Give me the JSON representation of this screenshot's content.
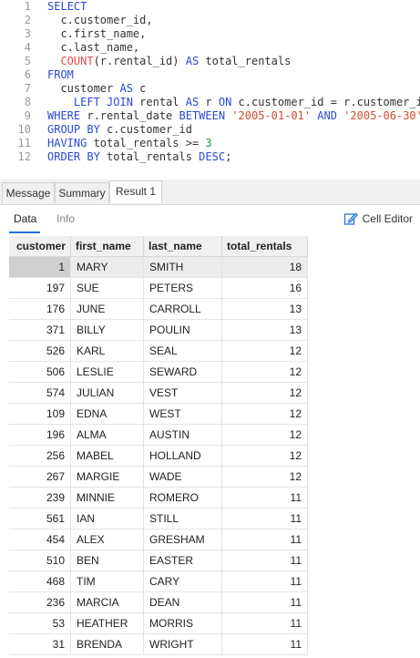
{
  "editor": {
    "lines": [
      {
        "n": "1",
        "parts": [
          {
            "t": "SELECT",
            "c": "kw"
          }
        ]
      },
      {
        "n": "2",
        "parts": [
          {
            "t": "  c.customer_id,",
            "c": "id"
          }
        ]
      },
      {
        "n": "3",
        "parts": [
          {
            "t": "  c.first_name,",
            "c": "id"
          }
        ]
      },
      {
        "n": "4",
        "parts": [
          {
            "t": "  c.last_name,",
            "c": "id"
          }
        ]
      },
      {
        "n": "5",
        "parts": [
          {
            "t": "  ",
            "c": "id"
          },
          {
            "t": "COUNT",
            "c": "fn"
          },
          {
            "t": "(r.rental_id) ",
            "c": "id"
          },
          {
            "t": "AS",
            "c": "kw"
          },
          {
            "t": " total_rentals",
            "c": "id"
          }
        ]
      },
      {
        "n": "6",
        "parts": [
          {
            "t": "FROM",
            "c": "kw"
          }
        ]
      },
      {
        "n": "7",
        "parts": [
          {
            "t": "  customer ",
            "c": "id"
          },
          {
            "t": "AS",
            "c": "kw"
          },
          {
            "t": " c",
            "c": "id"
          }
        ]
      },
      {
        "n": "8",
        "parts": [
          {
            "t": "    ",
            "c": "id"
          },
          {
            "t": "LEFT JOIN",
            "c": "kw"
          },
          {
            "t": " rental ",
            "c": "id"
          },
          {
            "t": "AS",
            "c": "kw"
          },
          {
            "t": " r ",
            "c": "id"
          },
          {
            "t": "ON",
            "c": "kw"
          },
          {
            "t": " c.customer_id = r.customer_id",
            "c": "id"
          }
        ]
      },
      {
        "n": "9",
        "parts": [
          {
            "t": "WHERE",
            "c": "kw"
          },
          {
            "t": " r.rental_date ",
            "c": "id"
          },
          {
            "t": "BETWEEN",
            "c": "kw"
          },
          {
            "t": " ",
            "c": "id"
          },
          {
            "t": "'2005-01-01'",
            "c": "str"
          },
          {
            "t": " ",
            "c": "id"
          },
          {
            "t": "AND",
            "c": "kw"
          },
          {
            "t": " ",
            "c": "id"
          },
          {
            "t": "'2005-06-30'",
            "c": "str"
          }
        ]
      },
      {
        "n": "10",
        "parts": [
          {
            "t": "GROUP BY",
            "c": "kw"
          },
          {
            "t": " c.customer_id",
            "c": "id"
          }
        ]
      },
      {
        "n": "11",
        "parts": [
          {
            "t": "HAVING",
            "c": "kw"
          },
          {
            "t": " total_rentals >= ",
            "c": "id"
          },
          {
            "t": "3",
            "c": "num"
          }
        ]
      },
      {
        "n": "12",
        "parts": [
          {
            "t": "ORDER BY",
            "c": "kw"
          },
          {
            "t": " total_rentals ",
            "c": "id"
          },
          {
            "t": "DESC",
            "c": "kw"
          },
          {
            "t": ";",
            "c": "id"
          }
        ]
      }
    ]
  },
  "tabs": {
    "message": "Message",
    "summary": "Summary",
    "result": "Result 1"
  },
  "subtabs": {
    "data": "Data",
    "info": "Info",
    "cell_editor": "Cell Editor"
  },
  "table": {
    "columns": [
      "customer",
      "first_name",
      "last_name",
      "total_rentals"
    ],
    "rows": [
      [
        "1",
        "MARY",
        "SMITH",
        "18"
      ],
      [
        "197",
        "SUE",
        "PETERS",
        "16"
      ],
      [
        "176",
        "JUNE",
        "CARROLL",
        "13"
      ],
      [
        "371",
        "BILLY",
        "POULIN",
        "13"
      ],
      [
        "526",
        "KARL",
        "SEAL",
        "12"
      ],
      [
        "506",
        "LESLIE",
        "SEWARD",
        "12"
      ],
      [
        "574",
        "JULIAN",
        "VEST",
        "12"
      ],
      [
        "109",
        "EDNA",
        "WEST",
        "12"
      ],
      [
        "196",
        "ALMA",
        "AUSTIN",
        "12"
      ],
      [
        "256",
        "MABEL",
        "HOLLAND",
        "12"
      ],
      [
        "267",
        "MARGIE",
        "WADE",
        "12"
      ],
      [
        "239",
        "MINNIE",
        "ROMERO",
        "11"
      ],
      [
        "561",
        "IAN",
        "STILL",
        "11"
      ],
      [
        "454",
        "ALEX",
        "GRESHAM",
        "11"
      ],
      [
        "510",
        "BEN",
        "EASTER",
        "11"
      ],
      [
        "468",
        "TIM",
        "CARY",
        "11"
      ],
      [
        "236",
        "MARCIA",
        "DEAN",
        "11"
      ],
      [
        "53",
        "HEATHER",
        "MORRIS",
        "11"
      ],
      [
        "31",
        "BRENDA",
        "WRIGHT",
        "11"
      ]
    ]
  },
  "colors": {
    "keyword": "#2a49d4",
    "function": "#e24c4c",
    "string": "#d24a2e",
    "number": "#1f9a3b",
    "tab_underline": "#2a6fdb"
  }
}
